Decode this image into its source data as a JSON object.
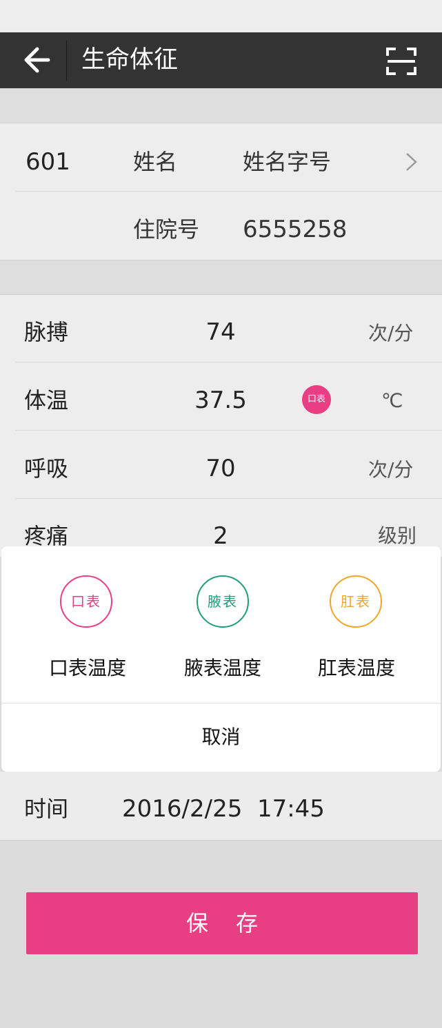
{
  "header": {
    "title": "生命体征"
  },
  "patient": {
    "bed": "601",
    "name_label": "姓名",
    "name_value": "姓名字号",
    "admission_label": "住院号",
    "admission_value": "6555258"
  },
  "vitals": {
    "pulse": {
      "label": "脉搏",
      "value": "74",
      "unit": "次/分"
    },
    "temperature": {
      "label": "体温",
      "value": "37.5",
      "method_badge": "口表",
      "unit": "℃"
    },
    "respiration": {
      "label": "呼吸",
      "value": "70",
      "unit": "次/分"
    },
    "pain": {
      "label": "疼痛",
      "value": "2",
      "unit": "级别"
    }
  },
  "sheet": {
    "options": [
      {
        "icon_text": "口表",
        "label": "口表温度",
        "color": "#e83e83"
      },
      {
        "icon_text": "腋表",
        "label": "腋表温度",
        "color": "#1f9e78"
      },
      {
        "icon_text": "肛表",
        "label": "肛表温度",
        "color": "#f3a42a"
      }
    ],
    "cancel_label": "取消"
  },
  "time": {
    "label": "时间",
    "value": "2016/2/25  17:45"
  },
  "save_label": "保存",
  "colors": {
    "header_bg": "#333333",
    "accent": "#e83e83"
  }
}
